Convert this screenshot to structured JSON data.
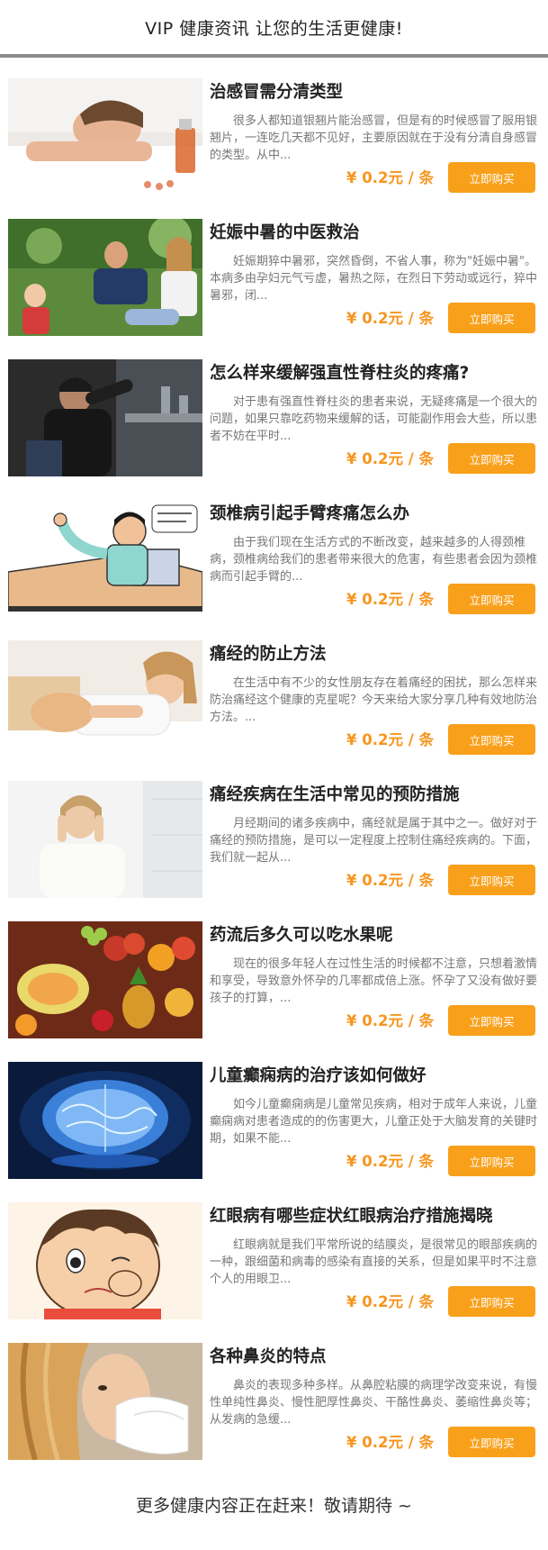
{
  "header": {
    "title": "VIP 健康资讯 让您的生活更健康!"
  },
  "buy_label": "立即购买",
  "accent": "#f9a01b",
  "items": [
    {
      "title": "治感冒需分清类型",
      "desc": "很多人都知道银翘片能治感冒，但是有的时候感冒了服用银翘片，一连吃几天都不见好，主要原因就在于没有分清自身感冒的类型。从中...",
      "price": "¥ 0.2元 / 条",
      "image": "sleeping-person-with-medicine"
    },
    {
      "title": "妊娠中暑的中医救治",
      "desc": "妊娠期猝中暑邪，突然昏倒，不省人事，称为\"妊娠中暑\"。本病多由孕妇元气亏虚，暑热之际，在烈日下劳动或远行，猝中暑邪，闭...",
      "price": "¥ 0.2元 / 条",
      "image": "family-outdoors"
    },
    {
      "title": "怎么样来缓解强直性脊柱炎的疼痛?",
      "desc": "对于患有强直性脊柱炎的患者来说，无疑疼痛是一个很大的问题，如果只靠吃药物来缓解的话，可能副作用会大些，所以患者不妨在平时...",
      "price": "¥ 0.2元 / 条",
      "image": "man-in-pain"
    },
    {
      "title": "颈椎病引起手臂疼痛怎么办",
      "desc": "由于我们现在生活方式的不断改变，越来越多的人得颈椎病，颈椎病给我们的患者带来很大的危害，有些患者会因为颈椎病而引起手臂的...",
      "price": "¥ 0.2元 / 条",
      "image": "cartoon-man-at-desk"
    },
    {
      "title": "痛经的防止方法",
      "desc": "在生活中有不少的女性朋友存在着痛经的困扰，那么怎样来防治痛经这个健康的克星呢？今天来给大家分享几种有效地防治方法。...",
      "price": "¥ 0.2元 / 条",
      "image": "woman-lying-down"
    },
    {
      "title": "痛经疾病在生活中常见的预防措施",
      "desc": "月经期间的诸多疾病中，痛经就是属于其中之一。做好对于痛经的预防措施，是可以一定程度上控制住痛经疾病的。下面，我们就一起从...",
      "price": "¥ 0.2元 / 条",
      "image": "stressed-woman"
    },
    {
      "title": "药流后多久可以吃水果呢",
      "desc": "现在的很多年轻人在过性生活的时候都不注意，只想着激情和享受，导致意外怀孕的几率都成倍上涨。怀孕了又没有做好要孩子的打算，...",
      "price": "¥ 0.2元 / 条",
      "image": "fruit-assortment"
    },
    {
      "title": "儿童癫痫病的治疗该如何做好",
      "desc": "如今儿童癫痫病是儿童常见疾病，相对于成年人来说，儿童癫痫病对患者造成的的伤害更大，儿童正处于大脑发育的关键时期，如果不能...",
      "price": "¥ 0.2元 / 条",
      "image": "glowing-brain"
    },
    {
      "title": "红眼病有哪些症状红眼病治疗措施揭晓",
      "desc": "红眼病就是我们平常所说的结膜炎，是很常见的眼部疾病的一种，跟细菌和病毒的感染有直接的关系，但是如果平时不注意个人的用眼卫...",
      "price": "¥ 0.2元 / 条",
      "image": "cartoon-child-rubbing-eye"
    },
    {
      "title": "各种鼻炎的特点",
      "desc": "鼻炎的表现多种多样。从鼻腔粘膜的病理学改变来说，有慢性单纯性鼻炎、慢性肥厚性鼻炎、干酪性鼻炎、萎缩性鼻炎等；从发病的急缓...",
      "price": "¥ 0.2元 / 条",
      "image": "woman-with-tissue"
    }
  ],
  "footer": {
    "text": "更多健康内容正在赶来！敬请期待 ~"
  }
}
